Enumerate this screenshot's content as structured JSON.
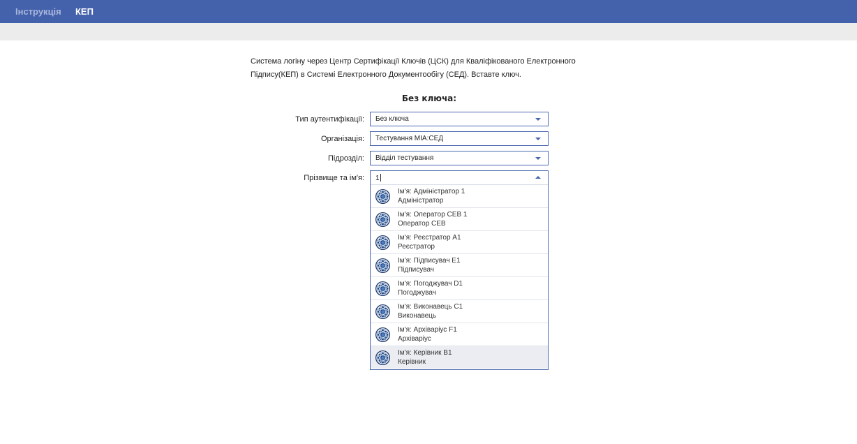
{
  "nav": {
    "instruction_label": "Інструкція",
    "kep_label": "КЕП"
  },
  "intro": {
    "line1": "Система логіну через Центр Сертифікації Ключів (ЦСК) для Кваліфікованого Електронного",
    "line2": "Підпису(КЕП) в Системі Електронного Документообігу (СЕД). Вставте ключ."
  },
  "form": {
    "title": "Без ключа:",
    "auth_type": {
      "label": "Тип аутентифікації:",
      "value": "Без ключа"
    },
    "organization": {
      "label": "Організація:",
      "value": "Тестування МІА:СЕД"
    },
    "department": {
      "label": "Підрозділ:",
      "value": "Відділ тестування"
    },
    "full_name": {
      "label": "Прізвище та ім'я:",
      "value": "1"
    }
  },
  "options": [
    {
      "name": "Ім'я: Адміністратор 1",
      "role": "Адміністратор"
    },
    {
      "name": "Ім'я: Оператор СЕВ 1",
      "role": "Оператор СЕВ"
    },
    {
      "name": "Ім'я: Реєстратор А1",
      "role": "Реєстратор"
    },
    {
      "name": "Ім'я: Підписувач Е1",
      "role": "Підписувач"
    },
    {
      "name": "Ім'я: Погоджувач D1",
      "role": "Погоджувач"
    },
    {
      "name": "Ім'я: Виконавець С1",
      "role": "Виконавець"
    },
    {
      "name": "Ім'я: Архіваріус F1",
      "role": "Архіваріус"
    },
    {
      "name": "Ім'я: Керівник В1",
      "role": "Керівник"
    }
  ],
  "colors": {
    "nav_bg": "#4461ab",
    "border": "#4a67ad",
    "hover_bg": "#ebedf2"
  },
  "icons": {
    "option_icon": "globe-seal-icon",
    "dropdown": "chevron-down-icon",
    "dropdown_open": "chevron-up-icon"
  }
}
